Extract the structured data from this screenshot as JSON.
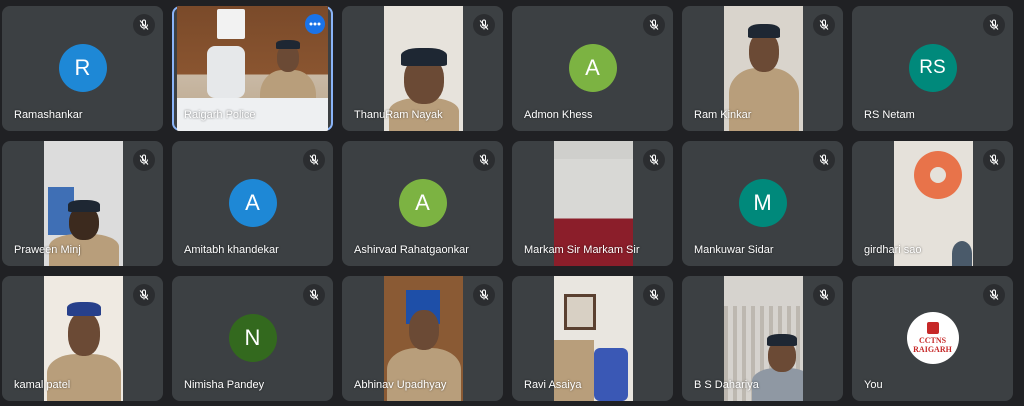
{
  "colors": {
    "background": "#202124",
    "tile": "#3c4043",
    "active_outline": "#8ab4f8",
    "more_button": "#1a73e8"
  },
  "participants": [
    {
      "name": "Ramashankar",
      "initial": "R",
      "avatar_color": "#1e88d6",
      "type": "avatar"
    },
    {
      "name": "Raigarh Police",
      "type": "video",
      "active": true
    },
    {
      "name": "ThanuRam Nayak",
      "type": "video"
    },
    {
      "name": "Admon Khess",
      "initial": "A",
      "avatar_color": "#7cb342",
      "type": "avatar"
    },
    {
      "name": "Ram Kinkar",
      "type": "video"
    },
    {
      "name": "RS Netam",
      "initial": "RS",
      "avatar_color": "#00897b",
      "type": "avatar"
    },
    {
      "name": "Praween Minj",
      "type": "video"
    },
    {
      "name": "Amitabh khandekar",
      "initial": "A",
      "avatar_color": "#1e88d6",
      "type": "avatar"
    },
    {
      "name": "Ashirvad Rahatgaonkar",
      "initial": "A",
      "avatar_color": "#7cb342",
      "type": "avatar"
    },
    {
      "name": "Markam Sir Markam Sir",
      "type": "video"
    },
    {
      "name": "Mankuwar Sidar",
      "initial": "M",
      "avatar_color": "#00897b",
      "type": "avatar"
    },
    {
      "name": "girdhari sao",
      "type": "video"
    },
    {
      "name": "kamal patel",
      "type": "video"
    },
    {
      "name": "Nimisha Pandey",
      "initial": "N",
      "avatar_color": "#33691e",
      "type": "avatar"
    },
    {
      "name": "Abhinav Upadhyay",
      "type": "video"
    },
    {
      "name": "Ravi Asaiya",
      "type": "video"
    },
    {
      "name": "B S Dahariya",
      "type": "video"
    },
    {
      "name": "You",
      "type": "logo",
      "logo_text": [
        "CCTNS",
        "RAIGARH"
      ]
    }
  ],
  "icons": {
    "mic": "mic-off-icon",
    "more": "more-options-icon"
  }
}
